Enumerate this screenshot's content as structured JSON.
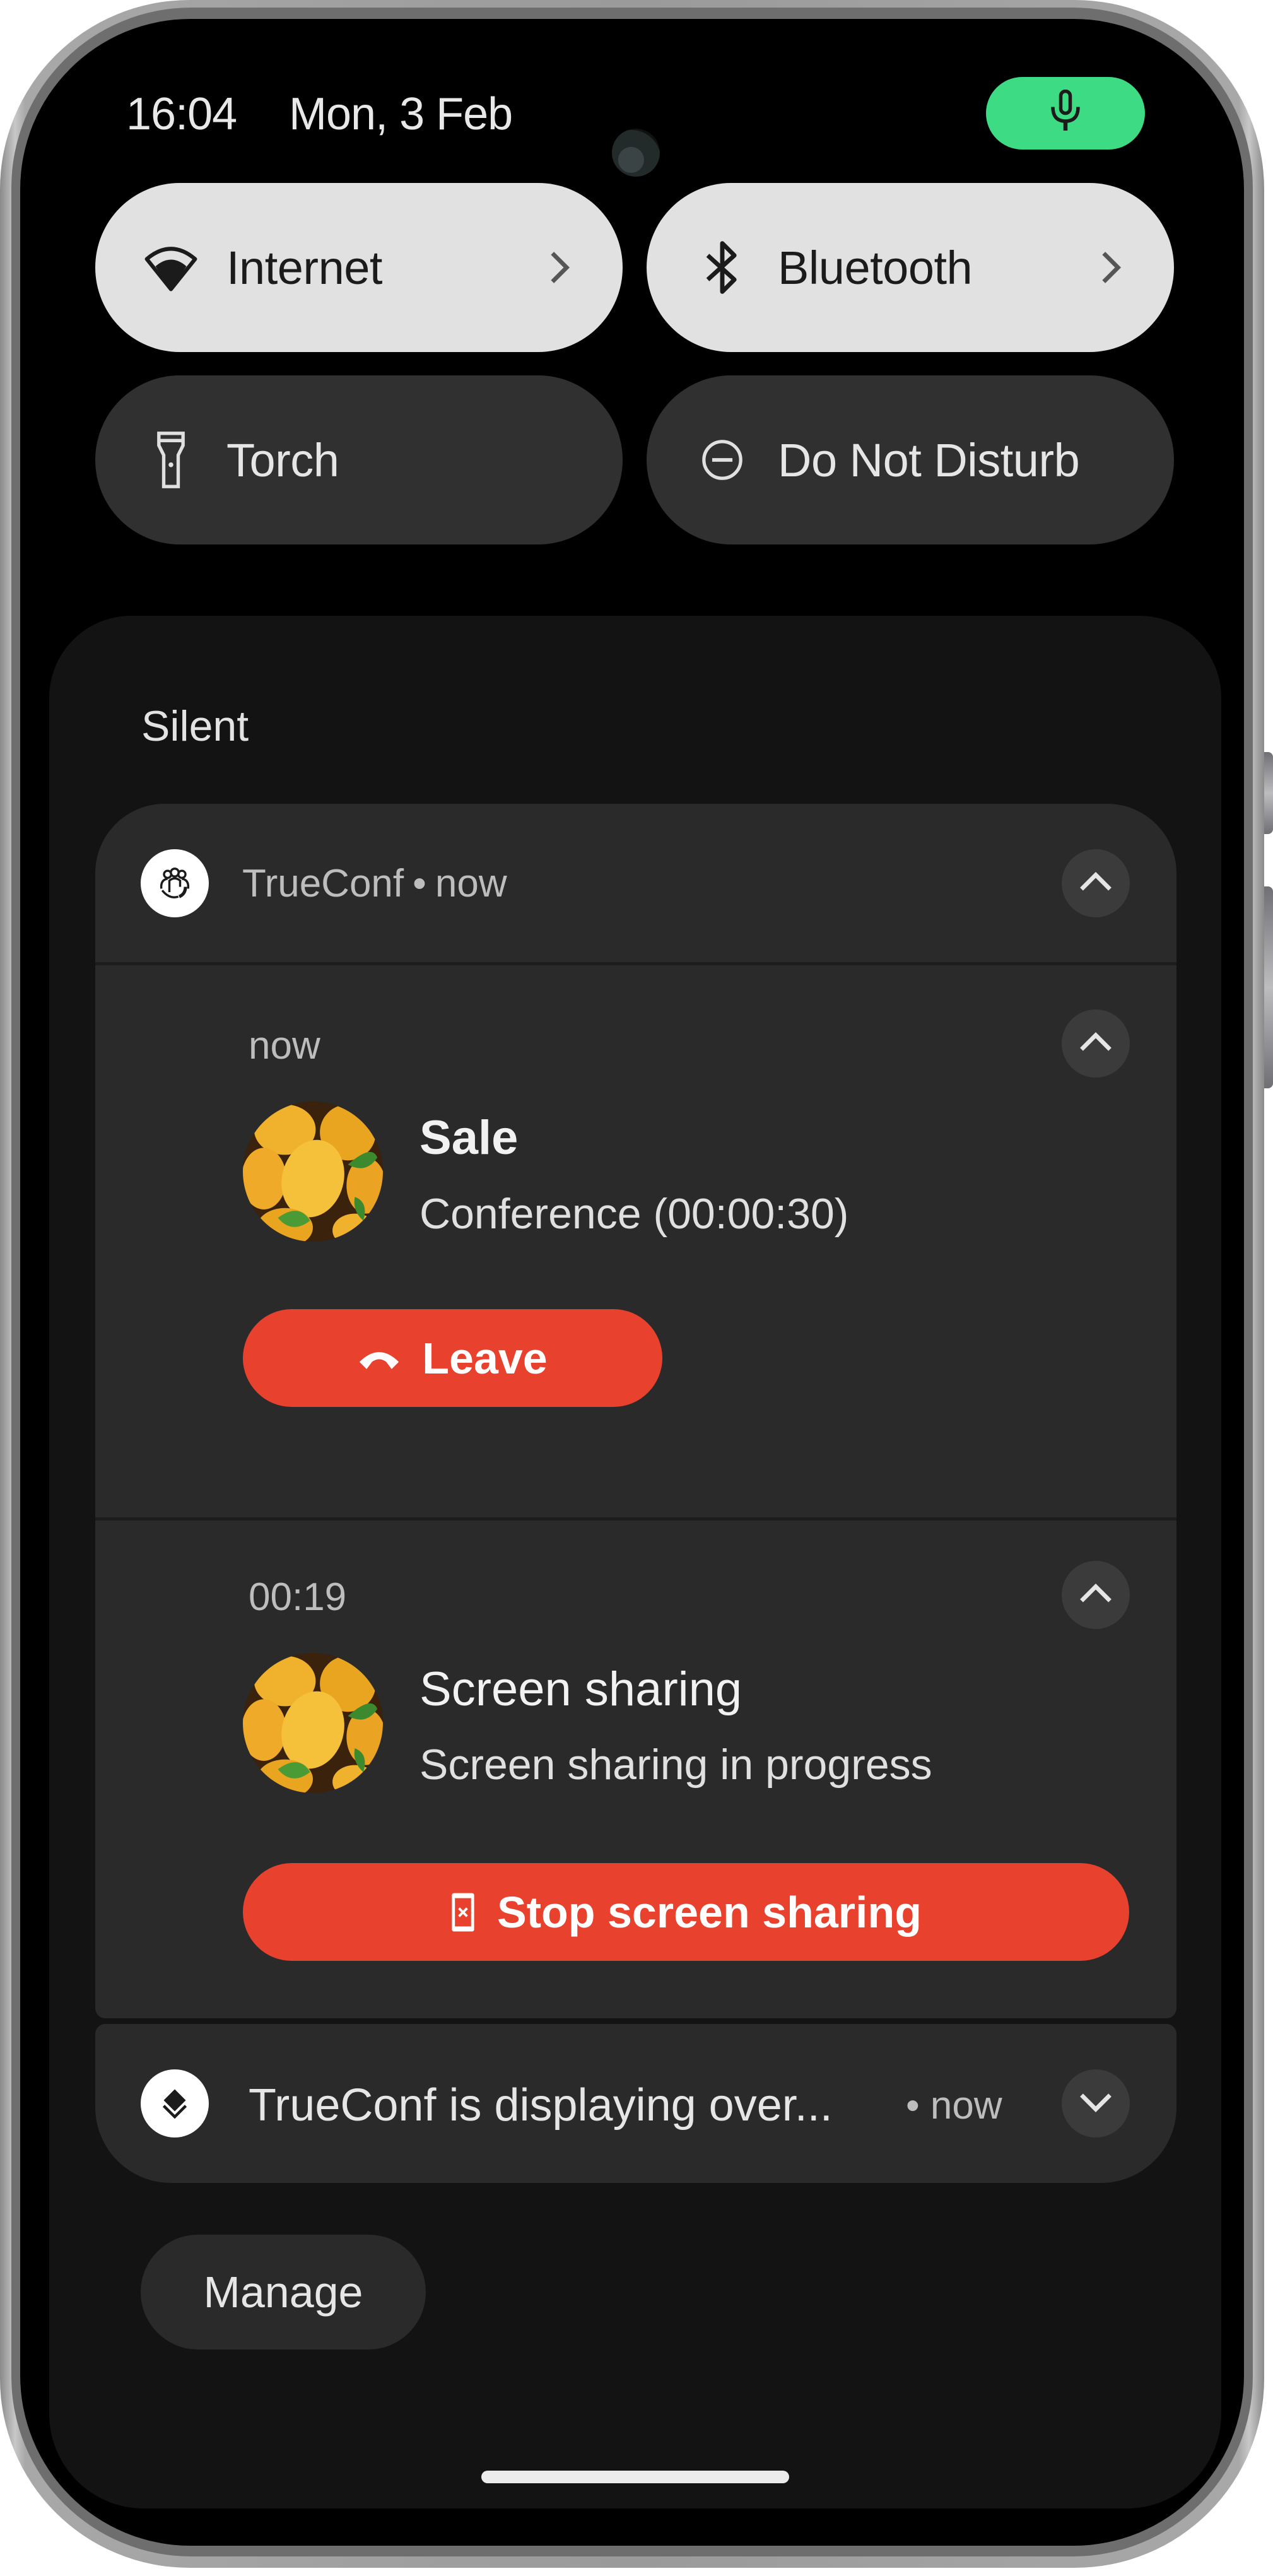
{
  "status_bar": {
    "time": "16:04",
    "date": "Mon, 3 Feb",
    "mic_indicator_icon": "microphone-icon",
    "mic_indicator_color": "#3ddc84"
  },
  "quick_settings": {
    "tiles": [
      {
        "label": "Internet",
        "icon": "wifi-icon",
        "state": "on",
        "has_chevron": true
      },
      {
        "label": "Bluetooth",
        "icon": "bluetooth-icon",
        "state": "on",
        "has_chevron": true
      },
      {
        "label": "Torch",
        "icon": "flashlight-icon",
        "state": "off",
        "has_chevron": false
      },
      {
        "label": "Do Not Disturb",
        "icon": "do-not-disturb-icon",
        "state": "off",
        "has_chevron": false
      }
    ]
  },
  "notifications": {
    "section_label": "Silent",
    "group": {
      "app_name": "TrueConf",
      "separator": "•",
      "time": "now",
      "app_icon": "trueconf-group-icon",
      "expand_icon": "chevron-up-icon",
      "items": [
        {
          "time": "now",
          "title": "Sale",
          "text": "Conference (00:00:30)",
          "avatar": "lemons-avatar",
          "action": {
            "label": "Leave",
            "icon": "call-end-icon"
          },
          "expand_icon": "chevron-up-icon"
        },
        {
          "time": "00:19",
          "title": "Screen sharing",
          "text": "Screen sharing in progress",
          "avatar": "lemons-avatar",
          "action": {
            "label": "Stop screen sharing",
            "icon": "stop-screen-share-icon"
          },
          "expand_icon": "chevron-up-icon"
        }
      ]
    },
    "overlay": {
      "text": "TrueConf is displaying over...",
      "time": "• now",
      "app_icon": "layers-icon",
      "expand_icon": "chevron-down-icon"
    },
    "manage_label": "Manage"
  },
  "colors": {
    "action_red": "#e8412e",
    "tile_on": "#e1e1e1",
    "tile_off": "#303030",
    "card_bg": "#2a2a2a",
    "panel_bg": "#131313"
  }
}
